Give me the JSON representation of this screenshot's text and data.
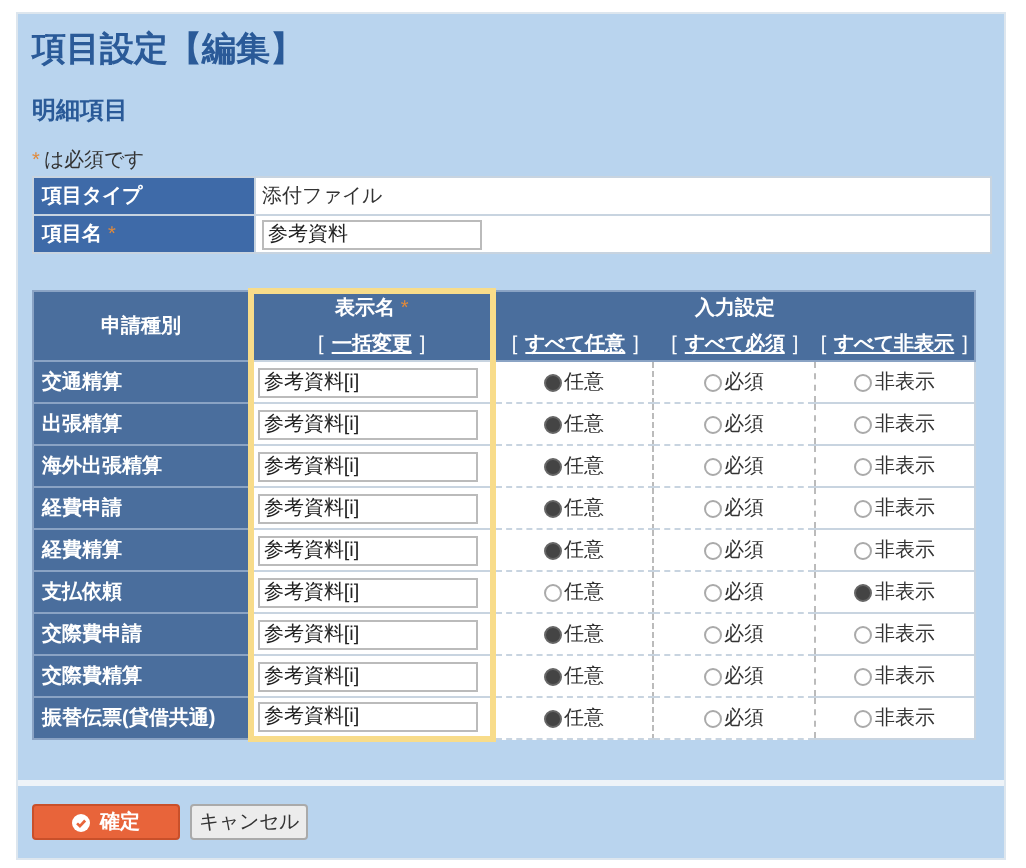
{
  "title": "項目設定【編集】",
  "section": "明細項目",
  "required_note": {
    "mark": "*",
    "text": "は必須です"
  },
  "info": [
    {
      "label": "項目タイプ",
      "kind": "text",
      "value": "添付ファイル"
    },
    {
      "label": "項目名",
      "mark": "*",
      "kind": "input",
      "value": "参考資料"
    }
  ],
  "table": {
    "type_header": "申請種別",
    "name_header": {
      "label": "表示名",
      "mark": "*",
      "link": {
        "open": "[",
        "text": "一括変更",
        "close": "]"
      }
    },
    "input_header": {
      "label": "入力設定",
      "links": [
        {
          "open": "[",
          "text": "すべて任意",
          "close": "]"
        },
        {
          "open": "[",
          "text": "すべて必須",
          "close": "]"
        },
        {
          "open": "[",
          "text": "すべて非表示",
          "close": "]"
        }
      ]
    },
    "rows": [
      {
        "type": "交通精算",
        "name": "参考資料[i]",
        "options": [
          {
            "label": "任意",
            "selected": true
          },
          {
            "label": "必須",
            "selected": false
          },
          {
            "label": "非表示",
            "selected": false
          }
        ]
      },
      {
        "type": "出張精算",
        "name": "参考資料[i]",
        "options": [
          {
            "label": "任意",
            "selected": true
          },
          {
            "label": "必須",
            "selected": false
          },
          {
            "label": "非表示",
            "selected": false
          }
        ]
      },
      {
        "type": "海外出張精算",
        "name": "参考資料[i]",
        "options": [
          {
            "label": "任意",
            "selected": true
          },
          {
            "label": "必須",
            "selected": false
          },
          {
            "label": "非表示",
            "selected": false
          }
        ]
      },
      {
        "type": "経費申請",
        "name": "参考資料[i]",
        "options": [
          {
            "label": "任意",
            "selected": true
          },
          {
            "label": "必須",
            "selected": false
          },
          {
            "label": "非表示",
            "selected": false
          }
        ]
      },
      {
        "type": "経費精算",
        "name": "参考資料[i]",
        "options": [
          {
            "label": "任意",
            "selected": true
          },
          {
            "label": "必須",
            "selected": false
          },
          {
            "label": "非表示",
            "selected": false
          }
        ]
      },
      {
        "type": "支払依頼",
        "name": "参考資料[i]",
        "options": [
          {
            "label": "任意",
            "selected": false
          },
          {
            "label": "必須",
            "selected": false
          },
          {
            "label": "非表示",
            "selected": true
          }
        ]
      },
      {
        "type": "交際費申請",
        "name": "参考資料[i]",
        "options": [
          {
            "label": "任意",
            "selected": true
          },
          {
            "label": "必須",
            "selected": false
          },
          {
            "label": "非表示",
            "selected": false
          }
        ]
      },
      {
        "type": "交際費精算",
        "name": "参考資料[i]",
        "options": [
          {
            "label": "任意",
            "selected": true
          },
          {
            "label": "必須",
            "selected": false
          },
          {
            "label": "非表示",
            "selected": false
          }
        ]
      },
      {
        "type": "振替伝票(貸借共通)",
        "name": "参考資料[i]",
        "options": [
          {
            "label": "任意",
            "selected": true
          },
          {
            "label": "必須",
            "selected": false
          },
          {
            "label": "非表示",
            "selected": false
          }
        ]
      }
    ]
  },
  "buttons": [
    {
      "label": "確定",
      "kind": "primary"
    },
    {
      "label": "キャンセル",
      "kind": "secondary"
    }
  ]
}
